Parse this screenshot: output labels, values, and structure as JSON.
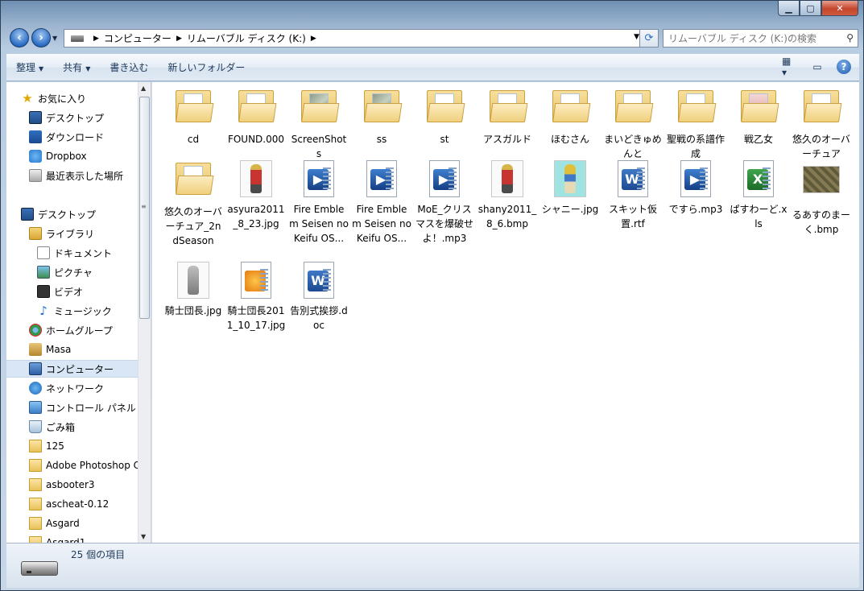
{
  "address": {
    "crumbs": [
      "コンピューター",
      "リムーバブル ディスク (K:)"
    ]
  },
  "search": {
    "placeholder": "リムーバブル ディスク (K:)の検索"
  },
  "toolbar": {
    "organize": "整理",
    "share": "共有",
    "burn": "書き込む",
    "new_folder": "新しいフォルダー"
  },
  "navpane": {
    "items": [
      {
        "label": "お気に入り",
        "icon": "star-icon"
      },
      {
        "label": "デスクトップ",
        "icon": "desktop-icon"
      },
      {
        "label": "ダウンロード",
        "icon": "downloads-icon"
      },
      {
        "label": "Dropbox",
        "icon": "dropbox-icon"
      },
      {
        "label": "最近表示した場所",
        "icon": "recent-places-icon"
      },
      {
        "label": "デスクトップ",
        "icon": "desktop-icon"
      },
      {
        "label": "ライブラリ",
        "icon": "library-icon"
      },
      {
        "label": "ドキュメント",
        "icon": "documents-icon"
      },
      {
        "label": "ピクチャ",
        "icon": "pictures-icon"
      },
      {
        "label": "ビデオ",
        "icon": "videos-icon"
      },
      {
        "label": "ミュージック",
        "icon": "music-icon"
      },
      {
        "label": "ホームグループ",
        "icon": "homegroup-icon"
      },
      {
        "label": "Masa",
        "icon": "user-folder-icon"
      },
      {
        "label": "コンピューター",
        "icon": "computer-icon"
      },
      {
        "label": "ネットワーク",
        "icon": "network-icon"
      },
      {
        "label": "コントロール パネル",
        "icon": "control-panel-icon"
      },
      {
        "label": "ごみ箱",
        "icon": "recycle-bin-icon"
      },
      {
        "label": "125",
        "icon": "folder-icon"
      },
      {
        "label": "Adobe Photoshop C",
        "icon": "folder-icon"
      },
      {
        "label": "asbooter3",
        "icon": "folder-icon"
      },
      {
        "label": "ascheat-0.12",
        "icon": "folder-icon"
      },
      {
        "label": "Asgard",
        "icon": "folder-icon"
      },
      {
        "label": "Asgard1",
        "icon": "folder-icon"
      }
    ]
  },
  "files": [
    {
      "name": "cd",
      "type": "folder"
    },
    {
      "name": "FOUND.000",
      "type": "folder"
    },
    {
      "name": "ScreenShots",
      "type": "folder"
    },
    {
      "name": "ss",
      "type": "folder"
    },
    {
      "name": "st",
      "type": "folder"
    },
    {
      "name": "アスガルド",
      "type": "folder"
    },
    {
      "name": "ほむさん",
      "type": "folder"
    },
    {
      "name": "まいどきゅめんと",
      "type": "folder"
    },
    {
      "name": "聖戦の系譜作成",
      "type": "folder"
    },
    {
      "name": "戦乙女",
      "type": "folder"
    },
    {
      "name": "悠久のオーバーチュア",
      "type": "folder"
    },
    {
      "name": "悠久のオーバーチュア_2ndSeason",
      "type": "folder"
    },
    {
      "name": "asyura2011_8_23.jpg",
      "type": "image"
    },
    {
      "name": "Fire Emblem Seisen no Keifu OS...",
      "type": "media"
    },
    {
      "name": "Fire Emblem Seisen no Keifu OS...",
      "type": "media"
    },
    {
      "name": "MoE_クリスマスを爆破せよ！.mp3",
      "type": "media"
    },
    {
      "name": "shany2011_8_6.bmp",
      "type": "image"
    },
    {
      "name": "シャニー.jpg",
      "type": "image"
    },
    {
      "name": "スキット仮置.rtf",
      "type": "word"
    },
    {
      "name": "ですら.mp3",
      "type": "media"
    },
    {
      "name": "ぱすわーど.xls",
      "type": "excel"
    },
    {
      "name": "るあすのまーく.bmp",
      "type": "image"
    },
    {
      "name": "騎士団長.jpg",
      "type": "image"
    },
    {
      "name": "騎士団長2011_10_17.jpg",
      "type": "image"
    },
    {
      "name": "告別式挨拶.doc",
      "type": "word"
    }
  ],
  "status": {
    "count": "25 個の項目"
  },
  "colors": {
    "accent": "#2a6cc4",
    "selection": "#d9e6f5",
    "frame": "#9bb4cf"
  }
}
